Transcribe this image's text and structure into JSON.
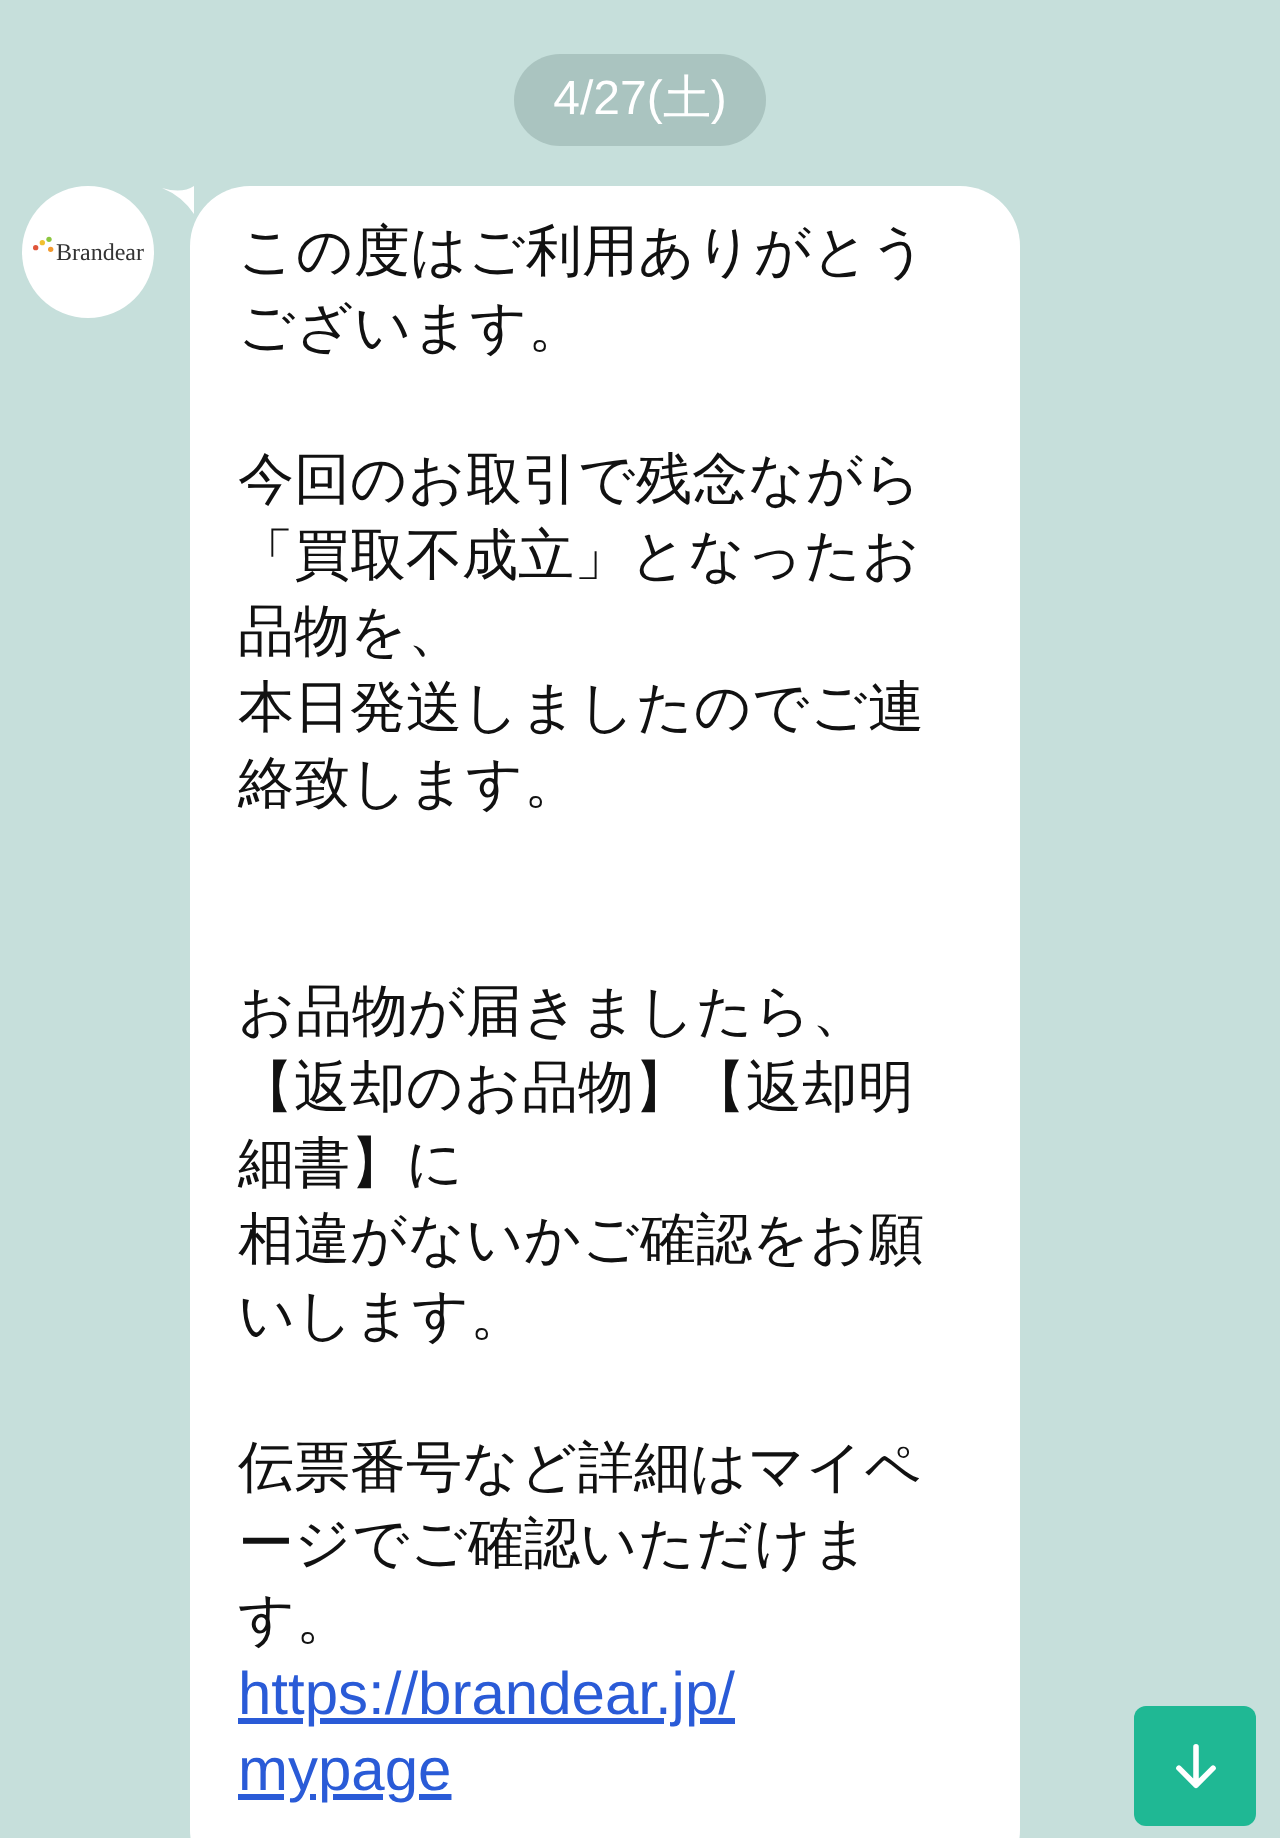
{
  "date_label": "4/27(土)",
  "message": {
    "sender_logo": "Brandear",
    "paragraphs": [
      {
        "lines": [
          "この度はご利用ありがとうございます。"
        ]
      },
      {
        "lines": [
          "今回のお取引で残念ながら「買取不成立」となったお品物を、",
          "本日発送しましたのでご連絡致します。"
        ]
      },
      {
        "lines": [
          "お品物が届きましたら、",
          "【返却のお品物】【返却明細書】に",
          "相違がないかご確認をお願いします。"
        ]
      },
      {
        "lines": [
          "伝票番号など詳細はマイページでご確認いただけます。"
        ]
      }
    ],
    "link": "https://brandear.jp/mypage"
  },
  "scroll_button": {
    "kind": "down"
  }
}
